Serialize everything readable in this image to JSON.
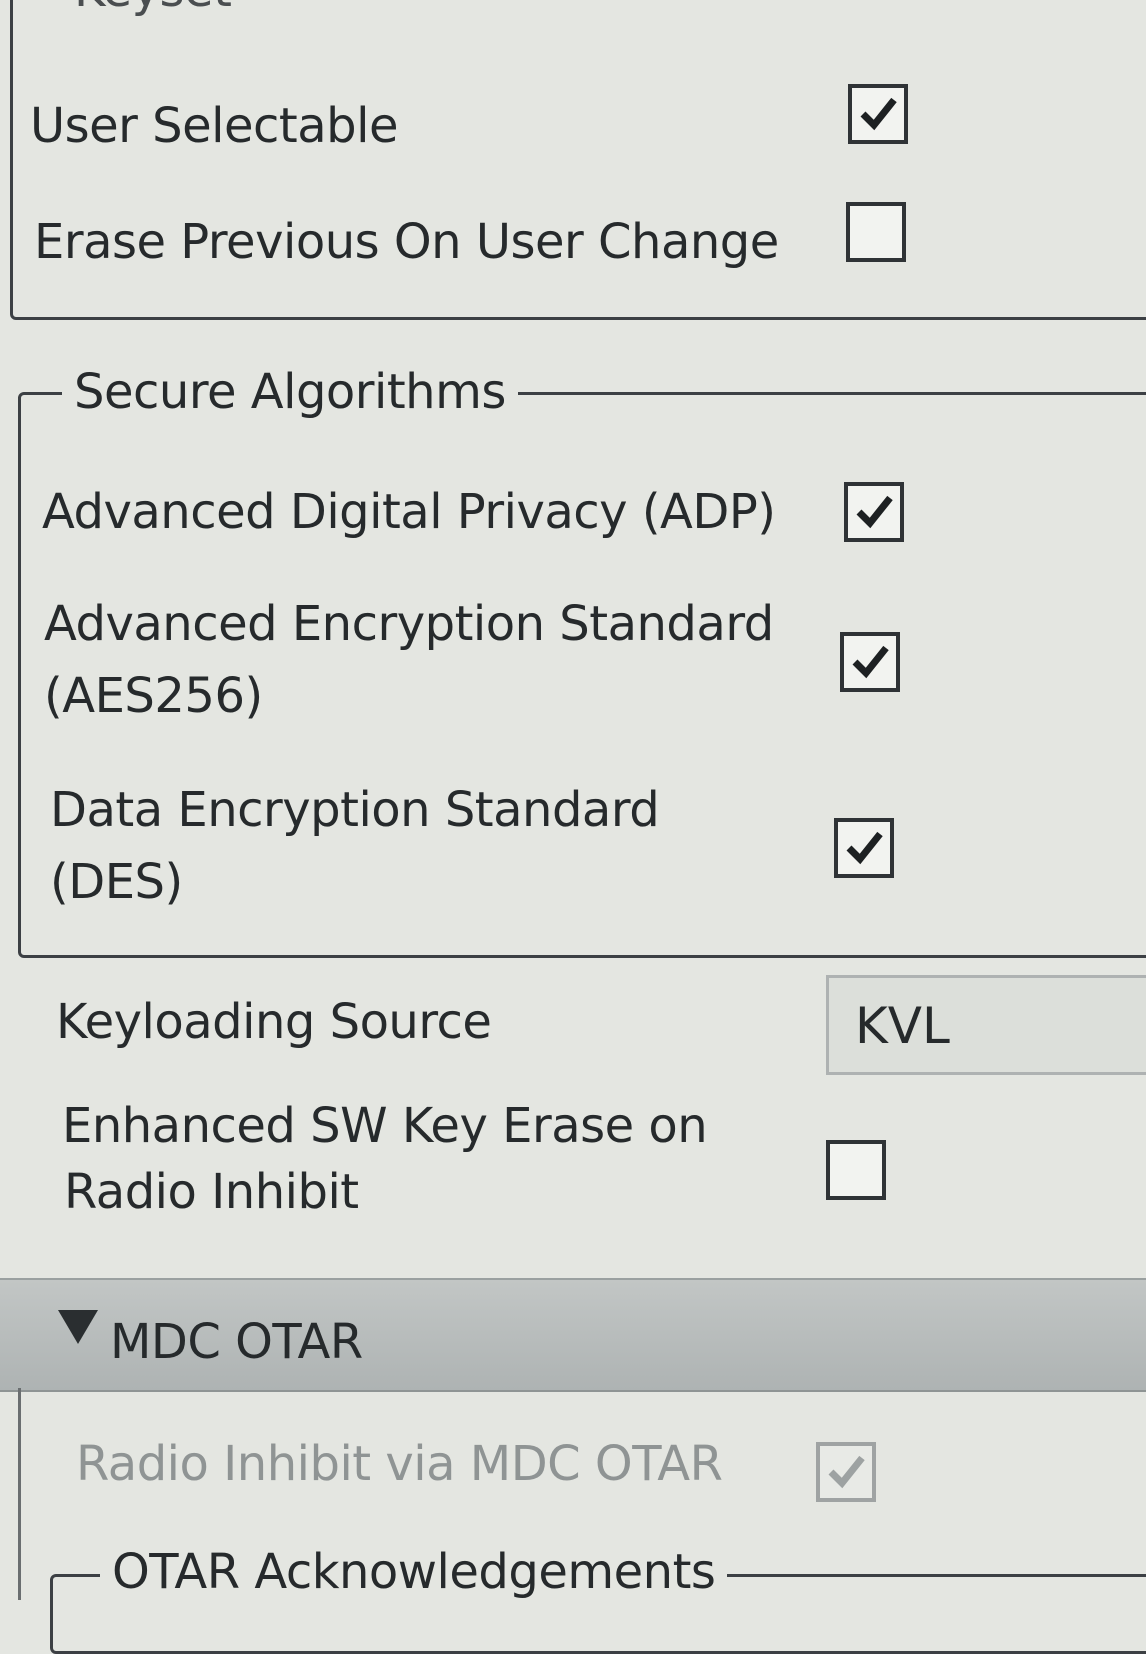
{
  "keyset": {
    "legend": "Keyset",
    "user_selectable": {
      "label": "User Selectable",
      "checked": true
    },
    "erase_previous": {
      "label": "Erase Previous On User Change",
      "checked": false
    }
  },
  "secure_algorithms": {
    "legend": "Secure Algorithms",
    "adp": {
      "label": "Advanced Digital Privacy (ADP)",
      "checked": true
    },
    "aes": {
      "label_line1": "Advanced Encryption Standard",
      "label_line2": "(AES256)",
      "checked": true
    },
    "des": {
      "label_line1": "Data Encryption Standard",
      "label_line2": "(DES)",
      "checked": true
    }
  },
  "keyloading": {
    "label": "Keyloading Source",
    "value": "KVL"
  },
  "enhanced_erase": {
    "label_line1": "Enhanced SW Key Erase on",
    "label_line2": "Radio Inhibit",
    "checked": false
  },
  "mdc_otar": {
    "title": "MDC OTAR",
    "radio_inhibit": {
      "label": "Radio Inhibit via MDC OTAR",
      "checked": true,
      "disabled": true
    },
    "ack_legend": "OTAR Acknowledgements"
  }
}
